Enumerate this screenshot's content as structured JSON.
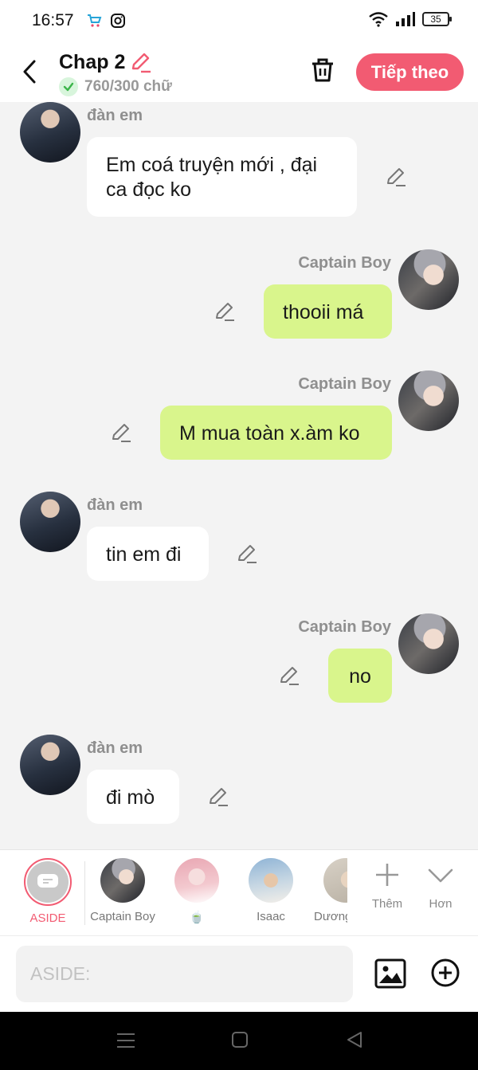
{
  "status_bar": {
    "time": "16:57",
    "battery": "35"
  },
  "header": {
    "title": "Chap 2",
    "word_count": "760/300 chữ",
    "next_button": "Tiếp theo"
  },
  "messages": [
    {
      "sender": "đàn em",
      "text": "Em coá truyện mới , đại ca đọc ko",
      "side": "left"
    },
    {
      "sender": "Captain Boy",
      "text": "thooii má",
      "side": "right"
    },
    {
      "sender": "Captain Boy",
      "text": "M mua toàn x.àm ko",
      "side": "right"
    },
    {
      "sender": "đàn em",
      "text": "tin em đi",
      "side": "left"
    },
    {
      "sender": "Captain Boy",
      "text": "no",
      "side": "right"
    },
    {
      "sender": "đàn em",
      "text": "đi mò",
      "side": "left"
    }
  ],
  "characters": [
    {
      "name": "ASIDE",
      "selected": true
    },
    {
      "name": "Captain Boy"
    },
    {
      "name": "🍵"
    },
    {
      "name": "Isaac"
    },
    {
      "name": "Dương"
    }
  ],
  "bar_actions": {
    "add": "Thêm",
    "more": "Hơn"
  },
  "input": {
    "placeholder": "ASIDE:"
  },
  "colors": {
    "accent": "#f25b72",
    "green_bubble": "#d9f58c",
    "check_green": "#3cb54a"
  },
  "icons": [
    "back-arrow-icon",
    "pencil-icon",
    "check-icon",
    "trash-icon",
    "plus-icon",
    "chevron-down-icon",
    "image-icon",
    "plus-circle-icon",
    "menu-icon",
    "home-icon",
    "back-triangle-icon"
  ]
}
